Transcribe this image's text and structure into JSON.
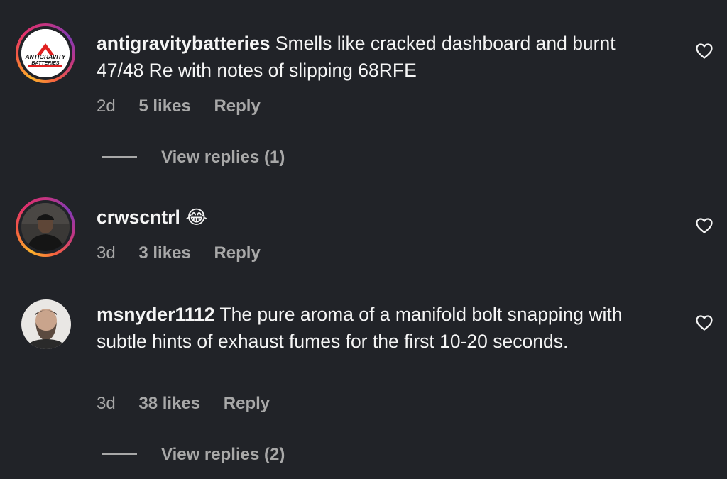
{
  "comments": [
    {
      "username": "antigravitybatteries",
      "text": "Smells like cracked dashboard and burnt 47/48 Re with notes of slipping 68RFE",
      "time": "2d",
      "likes": "5 likes",
      "reply": "Reply",
      "avatar_logo_text_1": "ANTIGRAVITY",
      "avatar_logo_text_2": "BATTERIES",
      "view_replies": "View replies (1)"
    },
    {
      "username": "crwscntrl",
      "text": "😂",
      "time": "3d",
      "likes": "3 likes",
      "reply": "Reply"
    },
    {
      "username": "msnyder1112",
      "text": "The pure aroma of a manifold bolt snapping with subtle hints of exhaust fumes for the first 10-20 seconds.",
      "time": "3d",
      "likes": "38 likes",
      "reply": "Reply",
      "view_replies": "View replies (2)"
    }
  ],
  "icons": {
    "like": "heart-outline-icon"
  },
  "colors": {
    "background": "#212328",
    "text_primary": "#f5f5f5",
    "text_secondary": "#a8a8a8",
    "logo_red": "#e02020"
  }
}
